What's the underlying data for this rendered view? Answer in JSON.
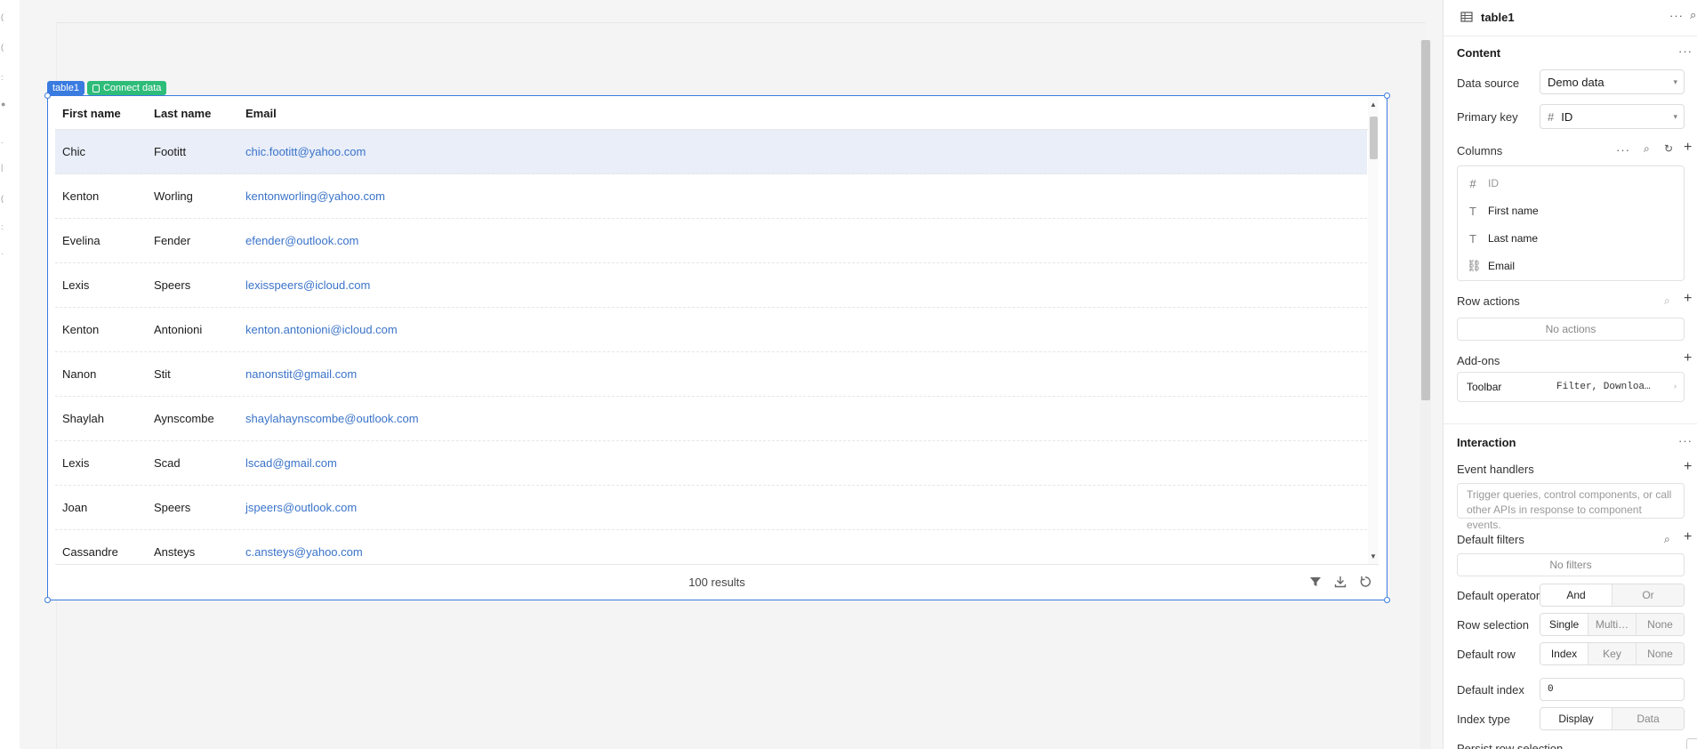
{
  "canvas": {
    "tags": {
      "component": "table1",
      "connect": "Connect data"
    },
    "table": {
      "headers": [
        "First name",
        "Last name",
        "Email"
      ],
      "rows": [
        {
          "first": "Chic",
          "last": "Footitt",
          "email": "chic.footitt@yahoo.com"
        },
        {
          "first": "Kenton",
          "last": "Worling",
          "email": "kentonworling@yahoo.com"
        },
        {
          "first": "Evelina",
          "last": "Fender",
          "email": "efender@outlook.com"
        },
        {
          "first": "Lexis",
          "last": "Speers",
          "email": "lexisspeers@icloud.com"
        },
        {
          "first": "Kenton",
          "last": "Antonioni",
          "email": "kenton.antonioni@icloud.com"
        },
        {
          "first": "Nanon",
          "last": "Stit",
          "email": "nanonstit@gmail.com"
        },
        {
          "first": "Shaylah",
          "last": "Aynscombe",
          "email": "shaylahaynscombe@outlook.com"
        },
        {
          "first": "Lexis",
          "last": "Scad",
          "email": "lscad@gmail.com"
        },
        {
          "first": "Joan",
          "last": "Speers",
          "email": "jspeers@outlook.com"
        },
        {
          "first": "Cassandre",
          "last": "Ansteys",
          "email": "c.ansteys@yahoo.com"
        }
      ],
      "selected_row": 0,
      "footer": "100 results",
      "footer_icons": [
        "filter-icon",
        "download-icon",
        "refresh-icon"
      ]
    }
  },
  "panel": {
    "title": "table1",
    "content": {
      "heading": "Content",
      "data_source_label": "Data source",
      "data_source_value": "Demo data",
      "primary_key_label": "Primary key",
      "primary_key_value": "ID",
      "columns_label": "Columns",
      "columns": [
        {
          "icon": "#",
          "name": "ID"
        },
        {
          "icon": "T",
          "name": "First name"
        },
        {
          "icon": "T",
          "name": "Last name"
        },
        {
          "icon": "link",
          "name": "Email"
        }
      ],
      "row_actions_label": "Row actions",
      "row_actions_empty": "No actions",
      "addons_label": "Add-ons",
      "toolbar_key": "Toolbar",
      "toolbar_value": "Filter, Downloa…"
    },
    "interaction": {
      "heading": "Interaction",
      "event_handlers_label": "Event handlers",
      "event_handlers_hint": "Trigger queries, control components, or call other APIs in response to component events.",
      "default_filters_label": "Default filters",
      "default_filters_empty": "No filters",
      "default_operator_label": "Default operator",
      "default_operator_options": [
        "And",
        "Or"
      ],
      "row_selection_label": "Row selection",
      "row_selection_options": [
        "Single",
        "Multi…",
        "None"
      ],
      "default_row_label": "Default row",
      "default_row_options": [
        "Index",
        "Key",
        "None"
      ],
      "default_index_label": "Default index",
      "default_index_value": "0",
      "index_type_label": "Index type",
      "index_type_options": [
        "Display",
        "Data"
      ],
      "persist_label": "Persist row selection"
    }
  },
  "colors": {
    "accent": "#3a7be0",
    "connect": "#2ebc79",
    "link": "#3a73c9",
    "selected_row": "#e9eef9"
  }
}
